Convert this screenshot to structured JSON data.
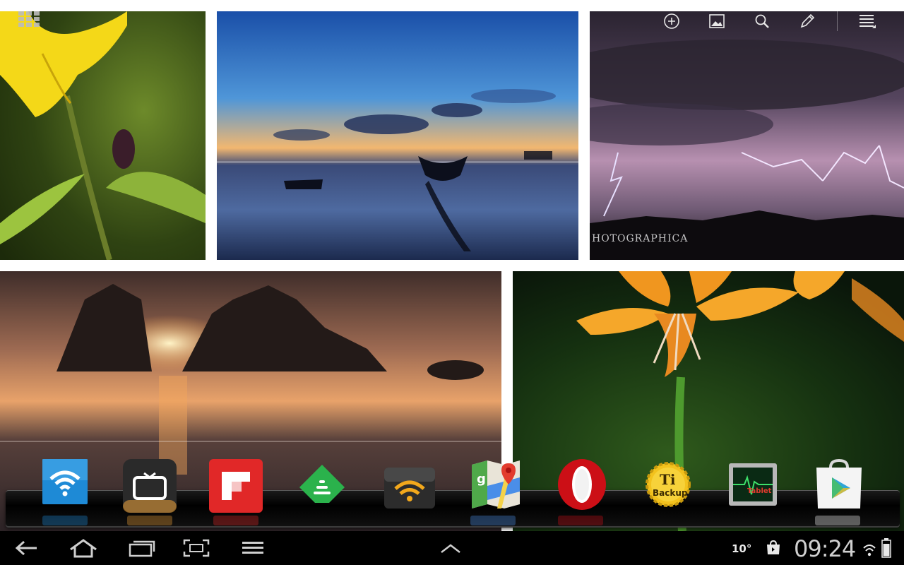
{
  "screen": "Android tablet home screen",
  "wallpaper_watermark": "HOTOGRAPHICA",
  "action_bar": {
    "icons": [
      "add-circle-icon",
      "wallpaper-icon",
      "search-icon",
      "pencil-icon",
      "menu-icon"
    ]
  },
  "dock": {
    "apps": [
      {
        "name": "wifi-app",
        "icon": "wifi-icon"
      },
      {
        "name": "tv-app",
        "icon": "tv-icon"
      },
      {
        "name": "flipboard-app",
        "icon": "flipboard-icon"
      },
      {
        "name": "feedly-app",
        "icon": "feedly-icon"
      },
      {
        "name": "wifi-hotspot-app",
        "icon": "wifi-hotspot-icon"
      },
      {
        "name": "maps-app",
        "icon": "maps-icon"
      },
      {
        "name": "opera-app",
        "icon": "opera-icon"
      },
      {
        "name": "titanium-backup-app",
        "icon": "titanium-backup-icon",
        "badge_text": "Backup",
        "badge_letters": "Ti"
      },
      {
        "name": "tablet-monitor-app",
        "icon": "tablet-monitor-icon",
        "badge_text": "Tablet"
      },
      {
        "name": "play-store-app",
        "icon": "play-store-icon"
      }
    ]
  },
  "status_bar": {
    "temperature": "10°",
    "time": "09:24"
  },
  "colors": {
    "system_bar": "#000000",
    "flipboard": "#e12828",
    "opera": "#cc0f16",
    "feedly": "#2bb24c",
    "wifi_blue": "#1e8ad6"
  }
}
